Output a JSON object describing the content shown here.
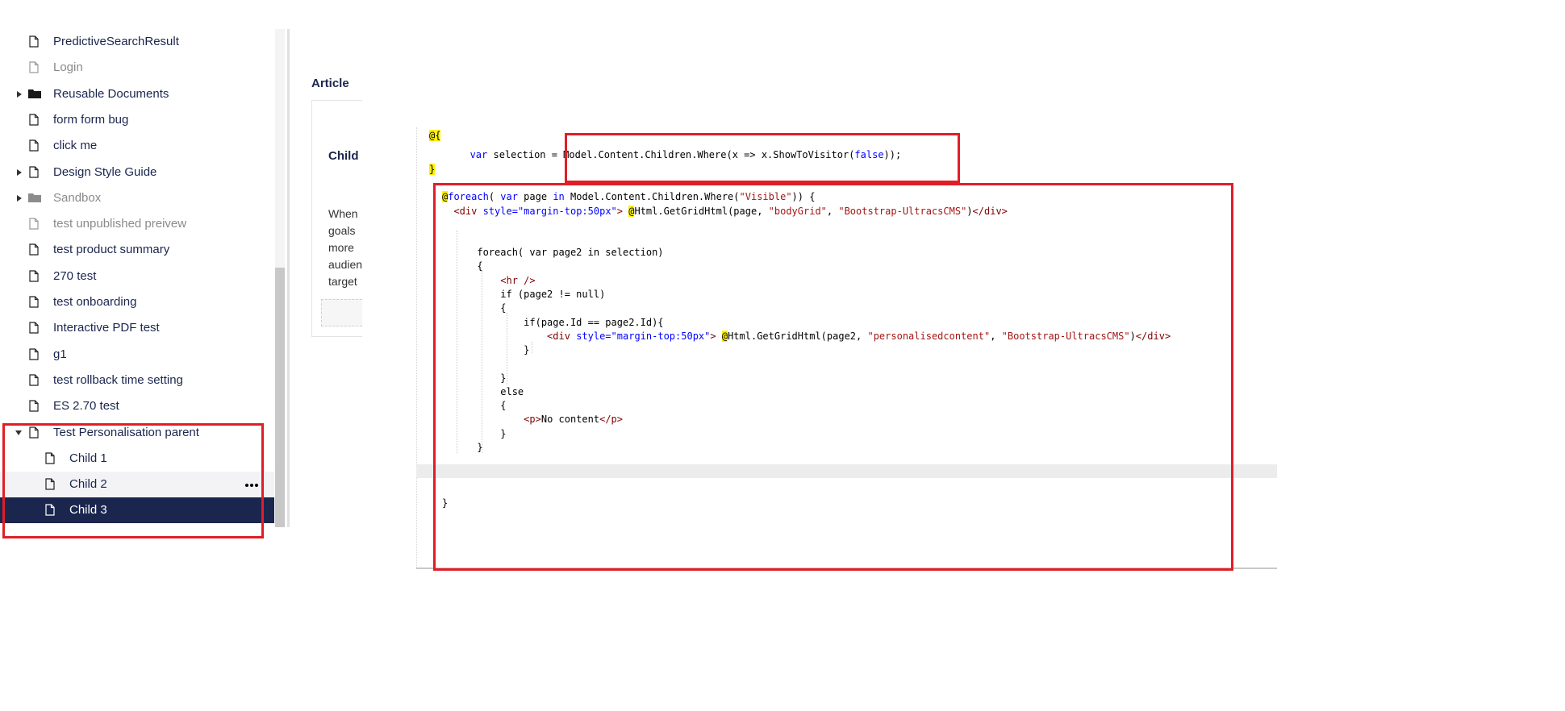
{
  "tree": {
    "items": [
      {
        "label": "PredictiveSearchResult",
        "icon": "document-icon"
      },
      {
        "label": "Login",
        "icon": "document-icon",
        "disabled": true
      },
      {
        "label": "Reusable Documents",
        "icon": "folder-icon",
        "expandable": true
      },
      {
        "label": "form form bug",
        "icon": "document-icon"
      },
      {
        "label": "click me",
        "icon": "document-icon"
      },
      {
        "label": "Design Style Guide",
        "icon": "document-icon",
        "expandable": true
      },
      {
        "label": "Sandbox",
        "icon": "folder-icon",
        "expandable": true,
        "disabled": true
      },
      {
        "label": "test unpublished preivew",
        "icon": "document-icon",
        "disabled": true
      },
      {
        "label": "test product summary",
        "icon": "document-icon"
      },
      {
        "label": "270 test",
        "icon": "document-icon"
      },
      {
        "label": "test onboarding",
        "icon": "document-icon"
      },
      {
        "label": "Interactive PDF test",
        "icon": "document-icon"
      },
      {
        "label": "g1",
        "icon": "document-icon"
      },
      {
        "label": "test rollback time setting",
        "icon": "document-icon"
      },
      {
        "label": "ES 2.70 test",
        "icon": "document-icon"
      },
      {
        "label": "Test Personalisation parent",
        "icon": "document-icon",
        "expanded": true
      },
      {
        "label": "Child 1",
        "icon": "document-icon",
        "child": true
      },
      {
        "label": "Child 2",
        "icon": "document-icon",
        "child": true,
        "hover": true
      },
      {
        "label": "Child 3",
        "icon": "document-icon",
        "child": true,
        "active": true
      }
    ]
  },
  "editor": {
    "section_label": "Article",
    "card_title": "Child",
    "card_text_lines": [
      "When",
      "goals",
      "more",
      "audien",
      "target"
    ]
  },
  "colors": {
    "highlight_red": "#e01e26",
    "nav_active": "#1b264f",
    "code_highlight": "#fff000"
  }
}
